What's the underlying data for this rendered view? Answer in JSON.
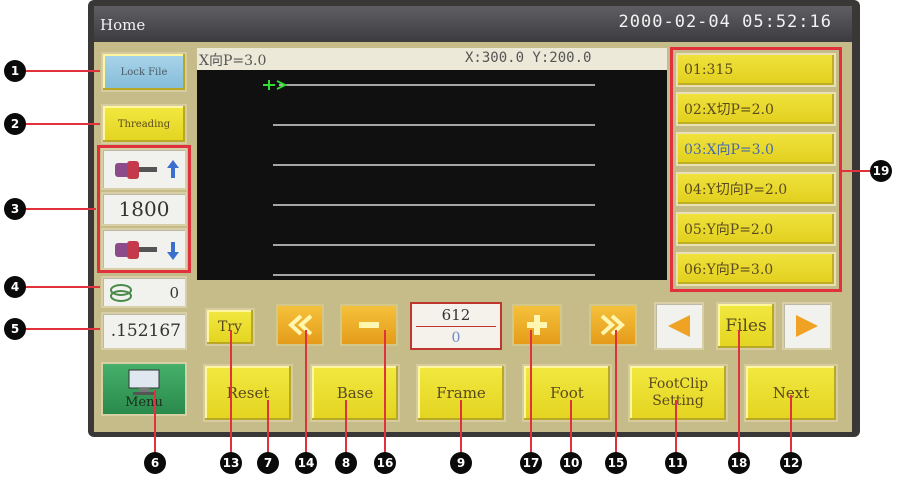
{
  "window": {
    "title": "Home",
    "datetime": "2000-02-04 05:52:16"
  },
  "left_panel": {
    "lock_file_label": "Lock File",
    "threading_label": "Threading",
    "speed_value": "1800",
    "counter_value": "0",
    "total_count": ".152167",
    "menu_label": "Menu"
  },
  "viewer": {
    "pattern_info": "X向P=3.0",
    "coords": "X:300.0 Y:200.0"
  },
  "file_list": [
    "01:315",
    "02:X切P=2.0",
    "03:X向P=3.0",
    "04:Y切向P=2.0",
    "05:Y向P=2.0",
    "06:Y向P=3.0"
  ],
  "controls": {
    "try_label": "Try",
    "stitch_number": "612",
    "stitch_sub": "0",
    "files_label": "Files"
  },
  "bottom_buttons": {
    "reset": "Reset",
    "base": "Base",
    "frame": "Frame",
    "foot": "Foot",
    "footclip": "FootClip Setting",
    "next": "Next"
  },
  "callouts": {
    "c1": "1",
    "c2": "2",
    "c3": "3",
    "c4": "4",
    "c5": "5",
    "c6": "6",
    "c7": "7",
    "c8": "8",
    "c9": "9",
    "c10": "10",
    "c11": "11",
    "c12": "12",
    "c13": "13",
    "c14": "14",
    "c15": "15",
    "c16": "16",
    "c17": "17",
    "c18": "18",
    "c19": "19"
  },
  "colors": {
    "screen_bg": "#c6bc8a",
    "button_yellow": "#e9dc2a",
    "highlight_red": "#e0313c",
    "arrow_orange": "#eca725"
  }
}
